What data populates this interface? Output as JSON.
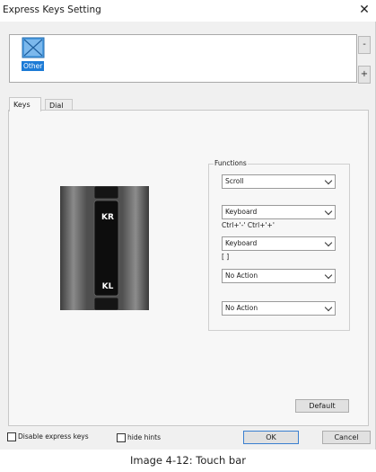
{
  "window": {
    "title": "Express Keys Setting",
    "close_glyph": "✕"
  },
  "app_list": {
    "selected_app": "Other",
    "app_icon": "other-app-icon",
    "side_buttons": [
      "-",
      "+"
    ]
  },
  "tabs": [
    {
      "label": "Keys",
      "active": true
    },
    {
      "label": "Dial",
      "active": false
    }
  ],
  "touch_bar": {
    "upper_key": "KR",
    "lower_key": "KL"
  },
  "functions": {
    "label": "Functions",
    "slots": [
      {
        "value": "Scroll",
        "detail": ""
      },
      {
        "value": "Keyboard",
        "detail": "Ctrl+'-'  Ctrl+'+'"
      },
      {
        "value": "Keyboard",
        "detail": "[ ]"
      },
      {
        "value": "No Action",
        "detail": ""
      },
      {
        "value": "No Action",
        "detail": ""
      }
    ]
  },
  "buttons": {
    "default": "Default",
    "ok": "OK",
    "cancel": "Cancel"
  },
  "checkboxes": {
    "disable_express_keys": "Disable express keys",
    "hide_hints": "hide hints"
  },
  "caption": "Image 4-12: Touch bar",
  "colors": {
    "selection": "#1d7bd6",
    "primary_border": "#3a7fd0"
  }
}
